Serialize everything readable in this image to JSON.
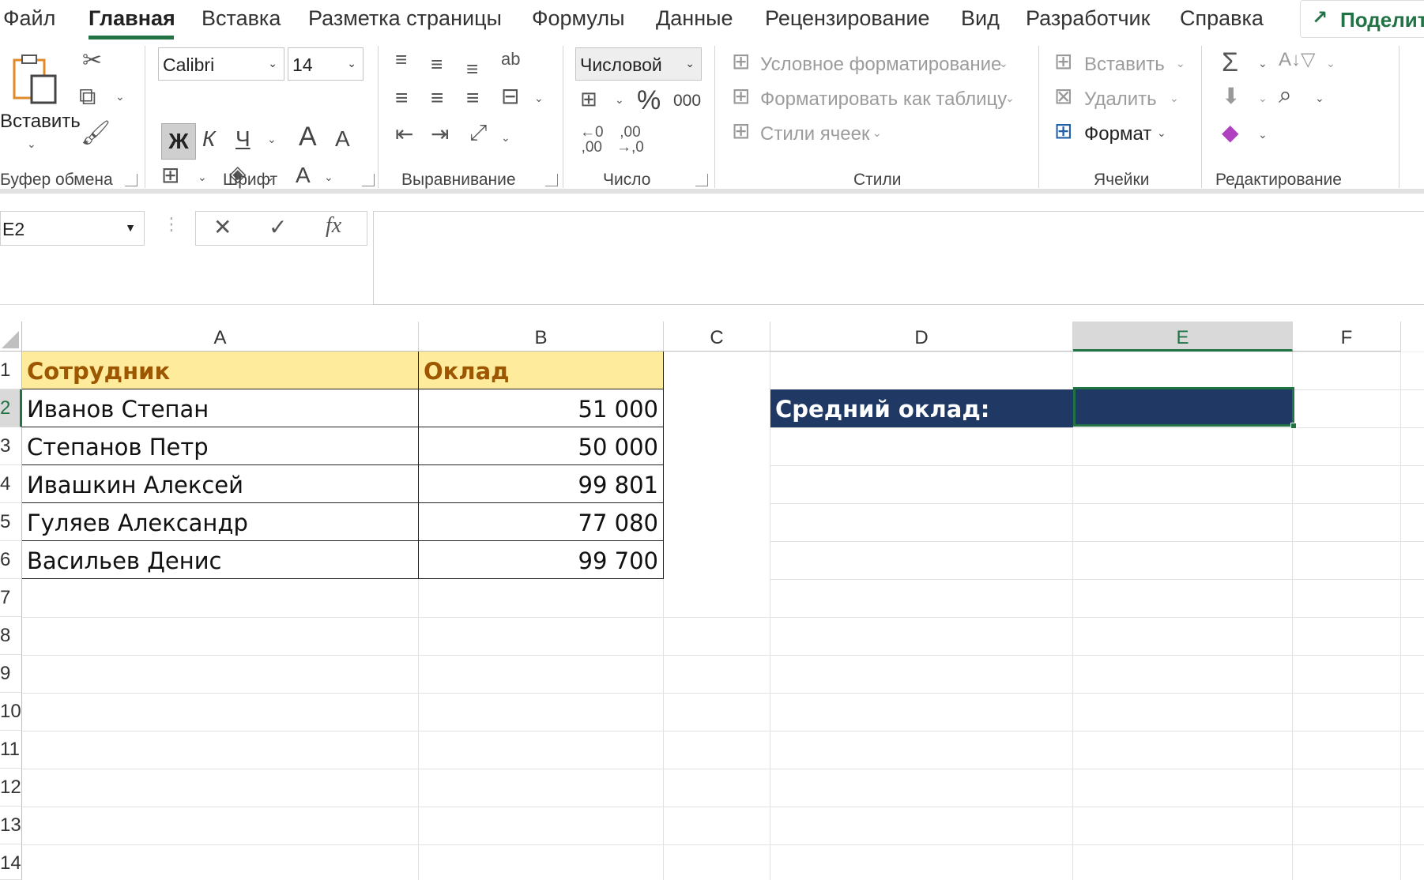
{
  "menu": {
    "tabs": [
      "Файл",
      "Главная",
      "Вставка",
      "Разметка страницы",
      "Формулы",
      "Данные",
      "Рецензирование",
      "Вид",
      "Разработчик",
      "Справка"
    ],
    "active_tab": "Главная",
    "share_label": "Поделит"
  },
  "ribbon": {
    "clipboard": {
      "paste_label": "Вставить",
      "group_label": "Буфер обмена"
    },
    "font": {
      "font_name": "Calibri",
      "font_size": "14",
      "bold": "Ж",
      "italic": "К",
      "underline": "Ч",
      "grow": "A",
      "shrink": "A",
      "color_a": "A",
      "group_label": "Шрифт"
    },
    "alignment": {
      "group_label": "Выравнивание"
    },
    "number": {
      "format": "Числовой",
      "percent": "%",
      "thousands": "000",
      "group_label": "Число"
    },
    "styles": {
      "conditional": "Условное форматирование",
      "as_table": "Форматировать как таблицу",
      "cell_styles": "Стили ячеек",
      "group_label": "Стили"
    },
    "cells": {
      "insert": "Вставить",
      "delete": "Удалить",
      "format": "Формат",
      "group_label": "Ячейки"
    },
    "editing": {
      "group_label": "Редактирование"
    }
  },
  "formula_bar": {
    "name_box": "E2",
    "formula": ""
  },
  "sheet": {
    "columns": [
      "A",
      "B",
      "C",
      "D",
      "E",
      "F"
    ],
    "selected_column": "E",
    "rows": [
      "1",
      "2",
      "3",
      "4",
      "5",
      "6",
      "7",
      "8",
      "9",
      "10",
      "11",
      "12",
      "13",
      "14"
    ],
    "selected_row": "2",
    "table_header": {
      "name": "Сотрудник",
      "salary": "Оклад"
    },
    "employees": [
      {
        "name": "Иванов Степан",
        "salary": "51 000"
      },
      {
        "name": "Степанов Петр",
        "salary": "50 000"
      },
      {
        "name": "Ивашкин Алексей",
        "salary": "99 801"
      },
      {
        "name": "Гуляев Александр",
        "salary": "77 080"
      },
      {
        "name": "Васильев Денис",
        "salary": "99 700"
      }
    ],
    "avg_label": "Средний оклад:",
    "avg_value": ""
  },
  "colors": {
    "accent": "#217346",
    "header_fill": "#ffeb9c",
    "header_text": "#9c5700",
    "navy": "#1f3864"
  }
}
